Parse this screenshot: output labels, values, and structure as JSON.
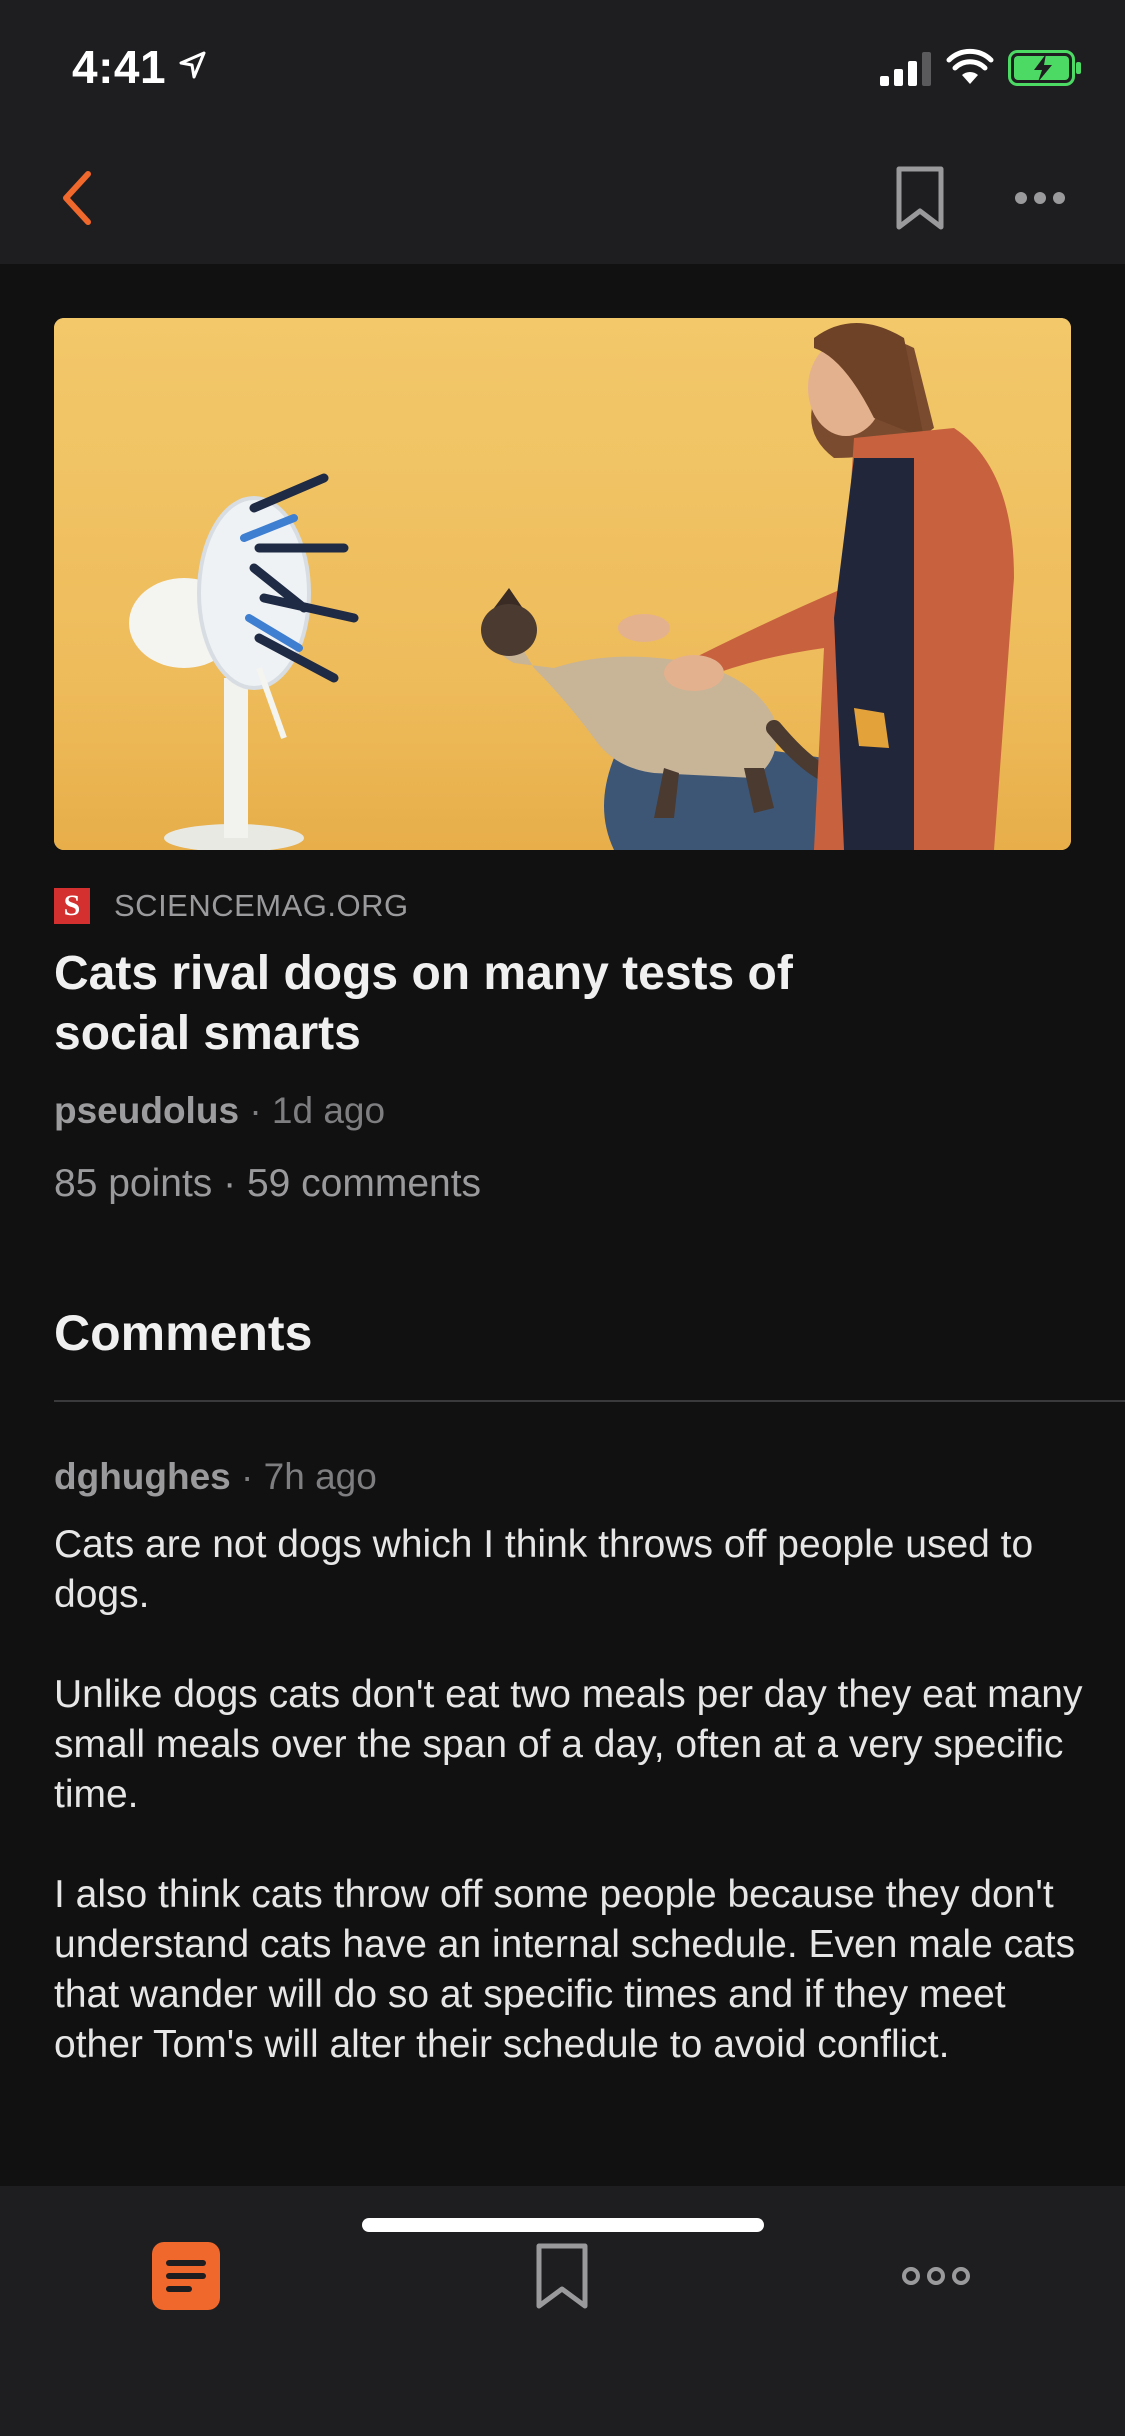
{
  "status_bar": {
    "time": "4:41"
  },
  "nav": {
    "back_icon": "chevron-left-icon",
    "bookmark_icon": "bookmark-icon",
    "more_icon": "ellipsis-icon"
  },
  "article": {
    "source_logo_letter": "S",
    "source": "SCIENCEMAG.ORG",
    "title": "Cats rival dogs on many tests of social smarts",
    "author": "pseudolus",
    "separator": "·",
    "age": "1d ago",
    "stats": "85 points · 59 comments"
  },
  "comments": {
    "heading": "Comments",
    "items": [
      {
        "author": "dghughes",
        "age": "7h ago",
        "paragraphs": [
          "Cats are not dogs which I think throws off people used to dogs.",
          "Unlike dogs cats don't eat two meals per day they eat many small meals over the span of a day, often at a very specific time.",
          "I also think cats throw off some people because they don't understand cats have an internal schedule. Even male cats that wander will do so at specific times and if they meet other Tom's will alter their schedule to avoid conflict."
        ]
      }
    ]
  },
  "tab_bar": {
    "tabs": [
      {
        "icon": "article-list-icon",
        "active": true
      },
      {
        "icon": "bookmark-icon",
        "active": false
      },
      {
        "icon": "more-icon",
        "active": false
      }
    ]
  },
  "colors": {
    "accent": "#f0682b",
    "background": "#111112",
    "bar_background": "#1e1e20",
    "battery_green": "#4cd964"
  }
}
